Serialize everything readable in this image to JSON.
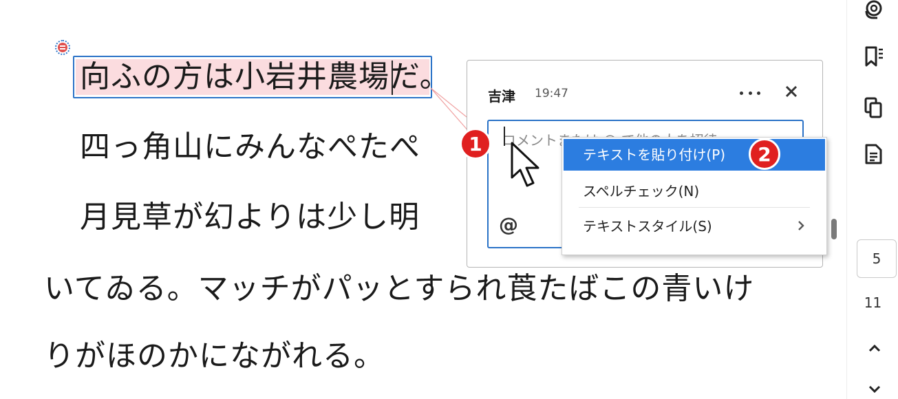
{
  "document": {
    "lines": [
      "向ふの方は小岩井農場だ。",
      "四っ角山にみんなぺたぺ",
      "月見草が幻よりは少し明",
      "いてゐる。マッチがパッとすられ莨たばこの青いけ",
      "りがほのかにながれる。"
    ]
  },
  "comment_panel": {
    "author": "吉津",
    "time": "19:47",
    "input_placeholder": "コメントまたは @ で他の人を招待"
  },
  "context_menu": {
    "items": [
      {
        "label": "テキストを貼り付け(P)"
      },
      {
        "label": "スペルチェック(N)"
      },
      {
        "label": "テキストスタイル(S)"
      }
    ]
  },
  "badges": [
    "1",
    "2"
  ],
  "sidebar": {
    "current_page": "5",
    "total_pages": "11"
  },
  "colors": {
    "accent": "#2c7de0",
    "highlight": "#fbdcdf",
    "badge": "#e02020"
  }
}
